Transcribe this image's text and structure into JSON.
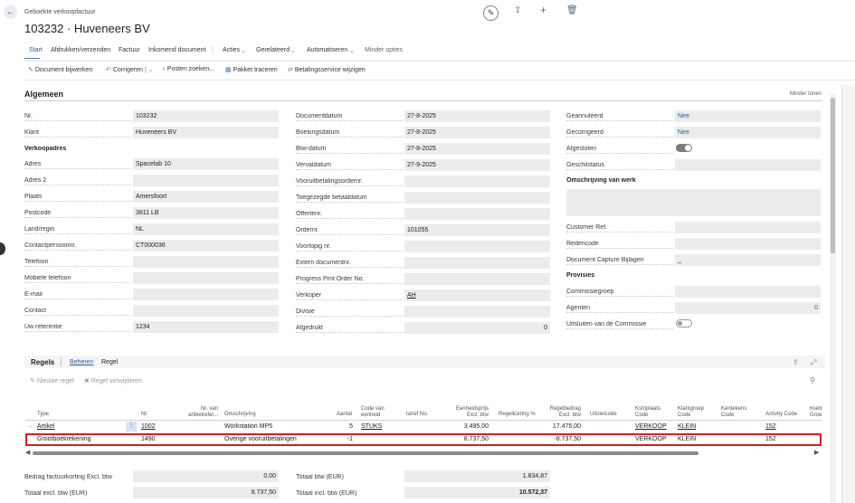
{
  "header": {
    "breadcrumb": "Geboekte verkoopfactuur",
    "title": "103232 · Huveneers BV",
    "back_glyph": "←",
    "icons": [
      "edit-icon",
      "share-icon",
      "add-icon",
      "delete-icon"
    ]
  },
  "menu": {
    "items": [
      "Start",
      "Afdrukken/verzenden",
      "Factuur",
      "Inkomend document",
      "Acties",
      "Gerelateerd",
      "Automatiseren",
      "Minder opties"
    ]
  },
  "actions": {
    "items": [
      "Document bijwerken",
      "Corrigeren",
      "Posten zoeken...",
      "Pakket traceren",
      "Betalingsservice wijzigen"
    ]
  },
  "general": {
    "title": "Algemeen",
    "show_less": "Minder tonen",
    "col1": {
      "nr_label": "Nr.",
      "nr": "103232",
      "klant_label": "Klant",
      "klant": "Huveneers BV",
      "verkoopadres": "Verkoopadres",
      "adres_label": "Adres",
      "adres": "Spacelab 10",
      "adres2_label": "Adres 2",
      "adres2": "",
      "plaats_label": "Plaats",
      "plaats": "Amersfoort",
      "postcode_label": "Postcode",
      "postcode": "3811 LB",
      "land_label": "Land/regio",
      "land": "NL",
      "contactnr_label": "Contactpersoonnr.",
      "contactnr": "CT000036",
      "telefoon_label": "Telefoon",
      "telefoon": "",
      "mobiel_label": "Mobiele telefoon",
      "mobiel": "",
      "email_label": "E-mail",
      "email": "",
      "contact_label": "Contact",
      "contact": "",
      "uwref_label": "Uw referentie",
      "uwref": "1234"
    },
    "col2": {
      "docdatum_label": "Documentdatum",
      "docdatum": "27-8-2025",
      "boekdatum_label": "Boekingsdatum",
      "boekdatum": "27-8-2025",
      "btwdatum_label": "Btw-datum",
      "btwdatum": "27-8-2025",
      "vervaldatum_label": "Vervaldatum",
      "vervaldatum": "27-9-2025",
      "voorsnr_label": "Vooruitbetalingsordernr.",
      "voorsnr": "",
      "toegezegd_label": "Toegezegde betaaldatum",
      "toegezegd": "",
      "offerte_label": "Offertenr.",
      "offerte": "",
      "ordernr_label": "Ordernr.",
      "ordernr": "101055",
      "voorlopig_label": "Voorlopig nr.",
      "voorlopig": "",
      "extern_label": "Extern documentnr.",
      "extern": "",
      "progress_label": "Progress Prnt Order No.",
      "progress": "",
      "verkoper_label": "Verkoper",
      "verkoper": "AH",
      "divisie_label": "Divisie",
      "divisie": "",
      "afgedrukt_label": "Afgedrukt",
      "afgedrukt": "0"
    },
    "col3": {
      "geannuleerd_label": "Geannuleerd",
      "geannuleerd": "Nee",
      "gecorrigeerd_label": "Gecorrigeerd",
      "gecorrigeerd": "Nee",
      "afgesloten_label": "Afgesloten",
      "geschilstatus_label": "Geschilstatus",
      "omschrijving_werk": "Omschrijving van werk",
      "custref_label": "Customer Ref.",
      "redencode_label": "Redencode",
      "capture_label": "Document Capture Bijlagen",
      "capture": "_",
      "provisies": "Provisies",
      "commissiegroep_label": "Commissiegroep",
      "agenten_label": "Agenten",
      "agenten": "0",
      "uitsluiten_label": "Uitsluiten van de Commissie",
      "afgesloten_on": true,
      "uitsluiten_on": false
    }
  },
  "lines": {
    "tab_label": "Regels",
    "tab_beheren": "Beheren",
    "tab_regel": "Regel",
    "new_line": "Nieuwe regel",
    "delete_line": "Regel verwijderen",
    "columns": [
      "Type",
      "Nr.",
      "Nr. van artikelrefer...",
      "Omschrijving",
      "Aantal",
      "Code van eenheid",
      "tarief No.",
      "Eenheidsprijs Excl. btw",
      "Regelkorting %",
      "Regelbedrag Excl. btw",
      "Uitstelcode",
      "Kstnplaats Code",
      "Klantgroep Code",
      "Kentekens Code",
      "Activity Code",
      "Klant Groe"
    ],
    "rows": [
      {
        "type": "Artikel",
        "nr": "1002",
        "omschrijving": "Workstation MP5",
        "aantal": "5",
        "eenheid": "STUKS",
        "prijs": "3.495,00",
        "bedrag": "17.475,00",
        "kstn": "VERKOOP",
        "klantgroep": "KLEIN",
        "activity": "152"
      },
      {
        "type": "Grootboekrekening",
        "nr": "1490",
        "omschrijving": "Overige vooruitbetalingen",
        "aantal": "-1",
        "eenheid": "",
        "prijs": "8.737,50",
        "bedrag": "-8.737,50",
        "kstn": "VERKOOP",
        "klantgroep": "KLEIN",
        "activity": "152"
      }
    ]
  },
  "totals": {
    "korting_label": "Bedrag factuurkorting Excl. btw",
    "korting": "0,00",
    "excl_label": "Totaal excl. btw (EUR)",
    "excl": "8.737,50",
    "btw_label": "Totaal btw (EUR)",
    "btw": "1.834,87",
    "incl_label": "Totaal incl. btw (EUR)",
    "incl": "10.572,37"
  }
}
